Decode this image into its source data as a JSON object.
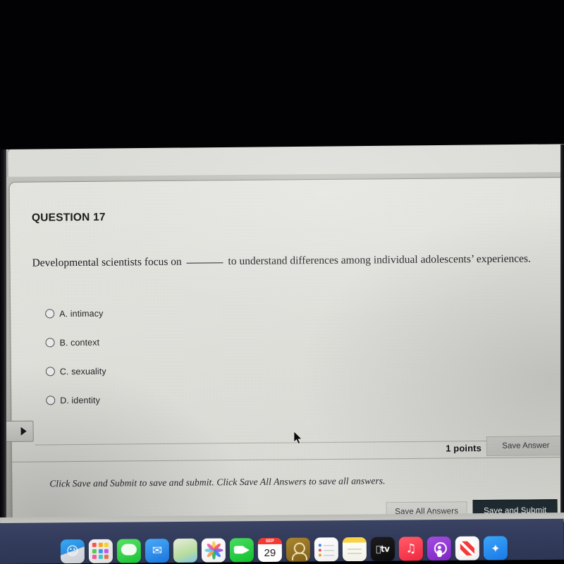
{
  "question": {
    "header": "QUESTION 17",
    "text_before": "Developmental  scientists  focus  on",
    "text_after": "to  understand  differences  among  individual  adolescents’ experiences.",
    "options": [
      {
        "letter": "A.",
        "label": "A. intimacy"
      },
      {
        "letter": "B.",
        "label": "B. context"
      },
      {
        "letter": "C.",
        "label": "C. sexuality"
      },
      {
        "letter": "D.",
        "label": "D. identity"
      }
    ],
    "points": "1 points",
    "save_answer_label": "Save Answer"
  },
  "footer": {
    "note": "Click Save and Submit to save and submit. Click Save All Answers to save all answers.",
    "save_all_label": "Save All Answers",
    "save_submit_label": "Save and Submit"
  },
  "colors": {
    "panel_bg": "#e4e5df",
    "page_bg": "#b8b8b2",
    "submit_btn": "#18252b",
    "light_btn": "#cdcec9",
    "text": "#15161a",
    "dock_bg": "#333c5c"
  },
  "dock": {
    "items": [
      {
        "name": "finder",
        "glyph": "☺",
        "bg": "linear-gradient(160deg,#3ea8ef 0%,#2f8ddb 48%,#d8dbe0 49%,#c9ccd2 100%)"
      },
      {
        "name": "launchpad",
        "glyph": "",
        "bg": "linear-gradient(160deg,#f2f2f2 0%,#dedede 100%)"
      },
      {
        "name": "messages",
        "glyph": "",
        "bg": "linear-gradient(160deg,#5ee06a 0%,#20c03a 100%)"
      },
      {
        "name": "mail",
        "glyph": "✉",
        "bg": "linear-gradient(160deg,#4ea9f2 0%,#1d74d8 100%)"
      },
      {
        "name": "maps",
        "glyph": "",
        "bg": "linear-gradient(160deg,#e9ecdf 0%,#b9dca0 60%,#7fc4e8 100%)"
      },
      {
        "name": "photos",
        "glyph": "",
        "bg": "linear-gradient(160deg,#fdfdfd 0%,#f1f1f1 100%)"
      },
      {
        "name": "facetime",
        "glyph": "",
        "bg": "linear-gradient(160deg,#4fd964 0%,#16bf32 100%)"
      },
      {
        "name": "calendar",
        "glyph": "",
        "bg": "#ffffff",
        "top": "SEP",
        "day": "29"
      },
      {
        "name": "contacts",
        "glyph": "",
        "bg": "linear-gradient(160deg,#a98632 0%,#7d5f1d 100%)"
      },
      {
        "name": "reminders",
        "glyph": "",
        "bg": "linear-gradient(160deg,#ffffff 0%,#eeeeee 100%)"
      },
      {
        "name": "notes",
        "glyph": "",
        "bg": "linear-gradient(180deg,#f4d24b 0%,#f4d24b 22%,#fdfdf6 23%,#f0f0e8 100%)"
      },
      {
        "name": "apple-tv",
        "glyph": " tv",
        "bg": "linear-gradient(160deg,#1d1d1f 0%,#0a0a0b 100%)"
      },
      {
        "name": "music",
        "glyph": "♫",
        "bg": "linear-gradient(160deg,#fc5e6a 0%,#e8293f 100%)"
      },
      {
        "name": "podcasts",
        "glyph": "",
        "bg": "linear-gradient(160deg,#a24fdc 0%,#7b27bd 100%)"
      },
      {
        "name": "news",
        "glyph": "",
        "bg": "linear-gradient(160deg,#fdfdfd 0%,#f0f0f0 100%)"
      },
      {
        "name": "app-store",
        "glyph": "A",
        "bg": "linear-gradient(160deg,#3fa4f5 0%,#1d78e0 100%)"
      }
    ]
  }
}
